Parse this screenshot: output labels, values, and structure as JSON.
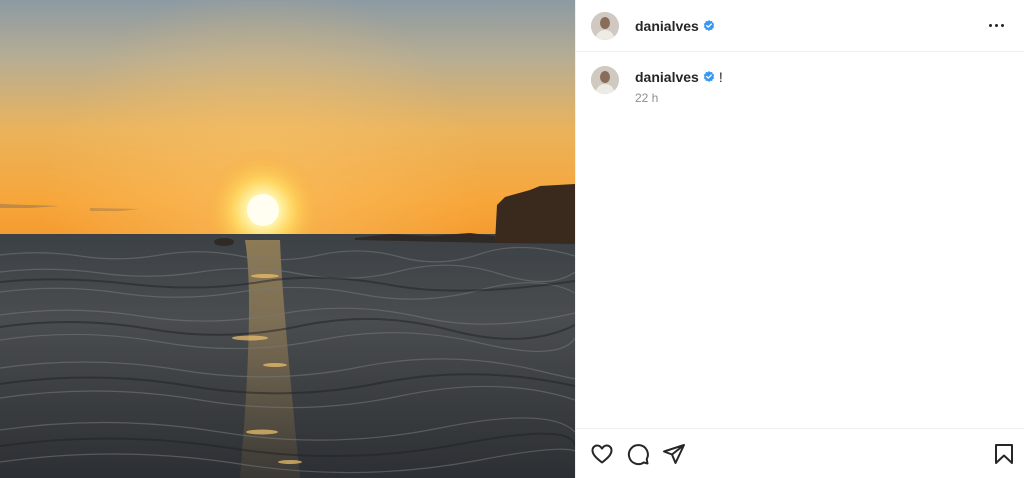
{
  "post": {
    "author": {
      "username": "danialves",
      "verified": true
    },
    "caption": {
      "username": "danialves",
      "text": "!",
      "time": "22 h"
    },
    "icons": {
      "more": "more-options-icon",
      "like": "heart-icon",
      "comment": "comment-icon",
      "share": "share-icon",
      "save": "bookmark-icon",
      "verified": "verified-badge-icon"
    },
    "colors": {
      "verified": "#3897f0",
      "text": "#262626",
      "muted": "#8e8e8e",
      "border": "#efefef"
    }
  }
}
